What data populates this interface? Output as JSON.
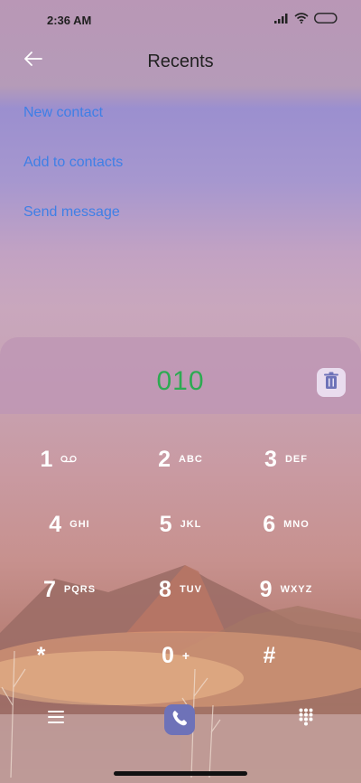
{
  "status_bar": {
    "time": "2:36 AM"
  },
  "header": {
    "title": "Recents"
  },
  "actions": [
    {
      "label": "New contact"
    },
    {
      "label": "Add to contacts"
    },
    {
      "label": "Send message"
    }
  ],
  "dialer": {
    "number": "010"
  },
  "keypad": [
    {
      "digit": "1",
      "letters": ""
    },
    {
      "digit": "2",
      "letters": "ABC"
    },
    {
      "digit": "3",
      "letters": "DEF"
    },
    {
      "digit": "4",
      "letters": "GHI"
    },
    {
      "digit": "5",
      "letters": "JKL"
    },
    {
      "digit": "6",
      "letters": "MNO"
    },
    {
      "digit": "7",
      "letters": "PQRS"
    },
    {
      "digit": "8",
      "letters": "TUV"
    },
    {
      "digit": "9",
      "letters": "WXYZ"
    },
    {
      "digit": "*",
      "letters": ""
    },
    {
      "digit": "0",
      "letters": "+"
    },
    {
      "digit": "#",
      "letters": ""
    }
  ],
  "icons": {
    "back": "arrow-left-icon",
    "delete": "trash-icon",
    "menu": "hamburger-icon",
    "call": "phone-icon",
    "dialpad": "dialpad-icon",
    "voicemail": "voicemail-icon"
  },
  "colors": {
    "link": "#3f7fe6",
    "dial_number": "#2daa52",
    "call_button": "#6e72b8"
  }
}
